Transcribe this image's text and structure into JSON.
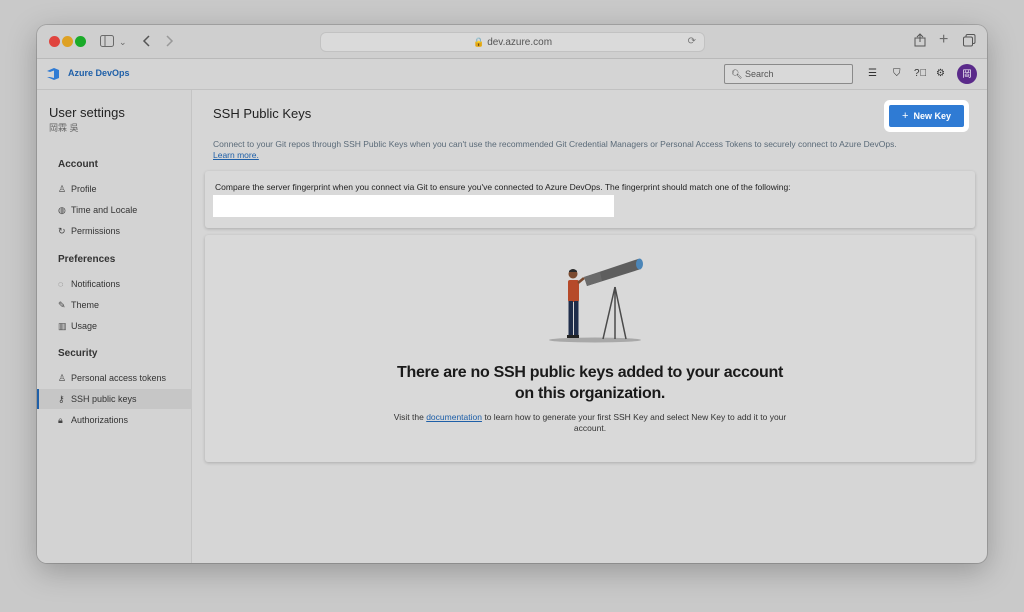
{
  "browser": {
    "url": "dev.azure.com"
  },
  "header": {
    "brand": "Azure DevOps",
    "search_placeholder": "Search",
    "avatar_initial": "岡"
  },
  "sidebar": {
    "title": "User settings",
    "user": "岡霖 吳",
    "sections": [
      {
        "heading": "Account",
        "items": [
          {
            "label": "Profile",
            "icon": "person-icon"
          },
          {
            "label": "Time and Locale",
            "icon": "globe-icon"
          },
          {
            "label": "Permissions",
            "icon": "refresh-icon"
          }
        ]
      },
      {
        "heading": "Preferences",
        "items": [
          {
            "label": "Notifications",
            "icon": "chat-icon"
          },
          {
            "label": "Theme",
            "icon": "paint-icon"
          },
          {
            "label": "Usage",
            "icon": "chart-icon"
          }
        ]
      },
      {
        "heading": "Security",
        "items": [
          {
            "label": "Personal access tokens",
            "icon": "person-key-icon"
          },
          {
            "label": "SSH public keys",
            "icon": "key-icon",
            "active": true
          },
          {
            "label": "Authorizations",
            "icon": "lock-icon"
          }
        ]
      }
    ]
  },
  "main": {
    "title": "SSH Public Keys",
    "new_key_label": "New Key",
    "description": "Connect to your Git repos through SSH Public Keys when you can't use the recommended Git Credential Managers or Personal Access Tokens to securely connect to Azure DevOps.",
    "learn_more": "Learn more.",
    "fingerprint_text": "Compare the server fingerprint when you connect via Git to ensure you've connected to Azure DevOps. The fingerprint should match one of the following:",
    "empty_title": "There are no SSH public keys added to your account on this organization.",
    "empty_sub_before": "Visit the ",
    "empty_sub_link": "documentation",
    "empty_sub_after": " to learn how to generate your first SSH Key and select New Key to add it to your account."
  },
  "colors": {
    "accent": "#2f7bd4",
    "brand": "#1e5fa8",
    "avatar": "#5a2a8a"
  }
}
